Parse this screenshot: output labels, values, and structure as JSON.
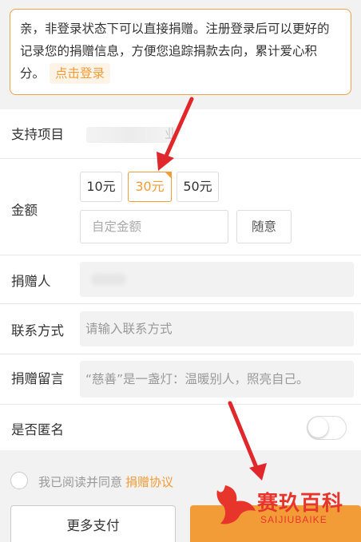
{
  "notice": {
    "text": "亲，非登录状态下可以直接捐赠。注册登录后可以更好的记录您的捐赠信息，方便您追踪捐款去向，累计爱心积分。",
    "login_label": "点击登录"
  },
  "project": {
    "label": "支持项目",
    "value_tail": "业"
  },
  "amount": {
    "label": "金额",
    "options": [
      "10元",
      "30元",
      "50元"
    ],
    "selected": "30元",
    "custom_placeholder": "自定金额",
    "any_label": "随意"
  },
  "donor": {
    "label": "捐赠人"
  },
  "contact": {
    "label": "联系方式",
    "placeholder": "请输入联系方式"
  },
  "message": {
    "label": "捐赠留言",
    "placeholder": "“慈善”是一盏灯：温暖别人，照亮自己。"
  },
  "anonymous": {
    "label": "是否匿名",
    "on": false
  },
  "agreement": {
    "text": "我已阅读并同意",
    "link": "捐赠协议"
  },
  "buttons": {
    "more_pay": "更多支付"
  },
  "watermark": {
    "title": "赛玖百科",
    "subtitle": "SAIJIUBAIKE"
  },
  "colors": {
    "accent": "#f29c38",
    "arrow": "#e0282c"
  }
}
